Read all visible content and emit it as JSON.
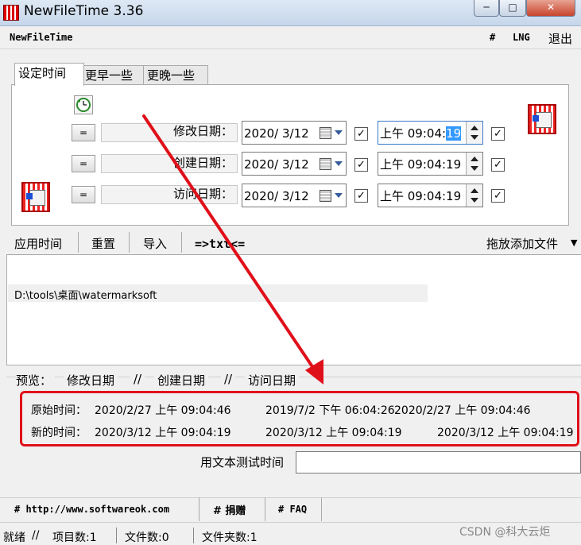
{
  "window": {
    "title": "NewFileTime 3.36",
    "controls": {
      "minimize": "─",
      "maximize": "□",
      "close": "✕"
    }
  },
  "menu": {
    "app_name": "NewFileTime",
    "hash": "#",
    "lng": "LNG",
    "exit": "退出"
  },
  "tabs": [
    {
      "label": "设定时间",
      "active": true
    },
    {
      "label": "更早一些",
      "active": false
    },
    {
      "label": "更晚一些",
      "active": false
    }
  ],
  "rows": [
    {
      "eq": "=",
      "label": "修改日期：",
      "date": "2020/ 3/12",
      "time_prefix": "上午 09:04:",
      "time_sel": "19",
      "checked_date": "✓",
      "checked_time": "✓"
    },
    {
      "eq": "=",
      "label": "创建日期：",
      "date": "2020/ 3/12",
      "time_prefix": "上午 09:04:19",
      "time_sel": "",
      "checked_date": "✓",
      "checked_time": "✓"
    },
    {
      "eq": "=",
      "label": "访问日期：",
      "date": "2020/ 3/12",
      "time_prefix": "上午 09:04:19",
      "time_sel": "",
      "checked_date": "✓",
      "checked_time": "✓"
    }
  ],
  "toolbar": {
    "apply": "应用时间",
    "reset": "重置",
    "import": "导入",
    "txt": "=>txt<=",
    "drop": "拖放添加文件",
    "drop_arrow": "▼"
  },
  "file_list": [
    "D:\\tools\\桌面\\watermarksoft"
  ],
  "preview": {
    "header": [
      "预览：",
      "修改日期",
      "//",
      "创建日期",
      "//",
      "访问日期"
    ],
    "original_label": "原始时间：",
    "original": [
      "2020/2/27 上午 09:04:46",
      "2019/7/2 下午 06:04:26",
      "2020/2/27 上午 09:04:46"
    ],
    "new_label": "新的时间：",
    "new": [
      "2020/3/12 上午 09:04:19",
      "2020/3/12 上午 09:04:19",
      "2020/3/12 上午 09:04:19"
    ]
  },
  "test": {
    "label": "用文本测试时间",
    "value": ""
  },
  "links": {
    "website": "# http://www.softwareok.com",
    "donate": "# 捐赠",
    "faq": "# FAQ"
  },
  "status": {
    "ready": "就绪",
    "sep": "//",
    "items": "项目数:1",
    "files": "文件数:0",
    "folders": "文件夹数:1",
    "watermark": "CSDN @科大云炬"
  },
  "colors": {
    "annotation_red": "#e0101a",
    "selection_blue": "#3399ff"
  }
}
